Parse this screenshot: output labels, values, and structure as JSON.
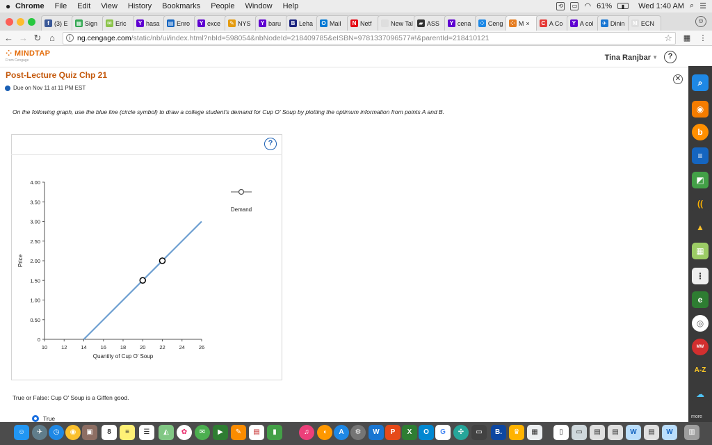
{
  "menubar": {
    "app": "Chrome",
    "items": [
      "File",
      "Edit",
      "View",
      "History",
      "Bookmarks",
      "People",
      "Window",
      "Help"
    ],
    "battery": "61%",
    "clock": "Wed 1:40 AM"
  },
  "tabs": [
    {
      "label": "(3) E",
      "fav": "f",
      "color": "#3b5998"
    },
    {
      "label": "Sign",
      "fav": "▦",
      "color": "#34a853"
    },
    {
      "label": "Eric",
      "fav": "✉",
      "color": "#8bc34a"
    },
    {
      "label": "hasa",
      "fav": "Y",
      "color": "#5f01d1"
    },
    {
      "label": "Enro",
      "fav": "▤",
      "color": "#1565c0"
    },
    {
      "label": "exce",
      "fav": "Y",
      "color": "#5f01d1"
    },
    {
      "label": "NYS",
      "fav": "✎",
      "color": "#e49b0f"
    },
    {
      "label": "baru",
      "fav": "Y",
      "color": "#5f01d1"
    },
    {
      "label": "Leha",
      "fav": "B",
      "color": "#1a237e"
    },
    {
      "label": "Mail",
      "fav": "O",
      "color": "#0078d4"
    },
    {
      "label": "Netf",
      "fav": "N",
      "color": "#e50914"
    },
    {
      "label": "New Tal",
      "fav": "",
      "color": "#dedede"
    },
    {
      "label": "ASS",
      "fav": "▰",
      "color": "#333333"
    },
    {
      "label": "cena",
      "fav": "Y",
      "color": "#5f01d1"
    },
    {
      "label": "Ceng",
      "fav": "⁘",
      "color": "#1e88e5"
    },
    {
      "label": "M",
      "fav": "⁘",
      "color": "#e67e22",
      "active": true
    },
    {
      "label": "A Co",
      "fav": "C",
      "color": "#e53935"
    },
    {
      "label": "A col",
      "fav": "Y",
      "color": "#5f01d1"
    },
    {
      "label": "Dinin",
      "fav": "✈",
      "color": "#1976d2"
    },
    {
      "label": "ECN",
      "fav": "M",
      "color": "#dedede"
    }
  ],
  "address": {
    "host": "ng.cengage.com",
    "path": "/static/nb/ui/index.html?nbId=598054&nbNodeId=218409785&eISBN=9781337096577#!&parentId=218410121"
  },
  "mindtap": {
    "logo": "MINDTAP",
    "logo_sub": "From Cengage",
    "user": "Tina Ranjbar",
    "help": "?"
  },
  "quiz": {
    "title": "Post-Lecture Quiz Chp 21",
    "due": "Due on Nov 11 at 11 PM EST",
    "question": "On the following graph, use the blue line (circle symbol) to draw a college student's demand for Cup O' Soup by plotting the optimum information from points A and B.",
    "tf_question": "True or False: Cup O' Soup is a Giffen good.",
    "option_true": "True"
  },
  "graph": {
    "help": "?",
    "legend": "Demand"
  },
  "chart_data": {
    "type": "line",
    "xlabel": "Quantity of Cup O' Soup",
    "ylabel": "Price",
    "xlim": [
      10,
      26
    ],
    "ylim": [
      0,
      4
    ],
    "x_ticks": [
      10,
      12,
      14,
      16,
      18,
      20,
      22,
      24,
      26
    ],
    "y_ticks": [
      "0",
      "0.50",
      "1.00",
      "1.50",
      "2.00",
      "2.50",
      "3.00",
      "3.50",
      "4.00"
    ],
    "series": [
      {
        "name": "Demand",
        "color": "#6d9fd1",
        "line": [
          [
            14,
            0
          ],
          [
            26,
            3
          ]
        ],
        "points": [
          [
            20,
            1.5
          ],
          [
            22,
            2.0
          ]
        ]
      }
    ]
  },
  "dock": {
    "more": "more"
  }
}
